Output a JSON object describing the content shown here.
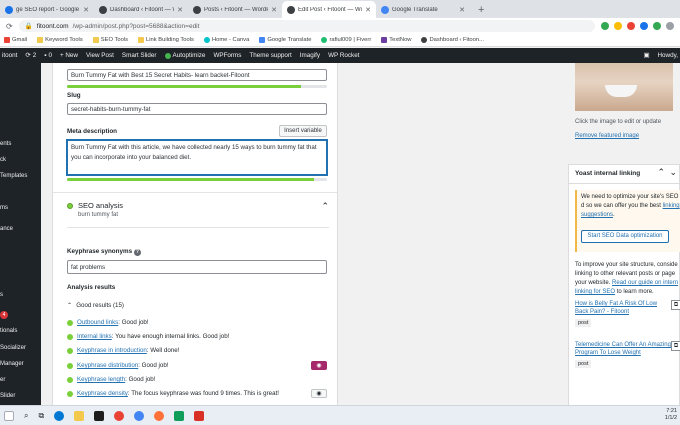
{
  "browser": {
    "tabs": [
      {
        "label": "ge SEO report - Google S",
        "color": "#1a73e8"
      },
      {
        "label": "Dashboard ‹ Fitoont — WordPre",
        "color": "#3c4043"
      },
      {
        "label": "Posts ‹ Fitoont — WordPress",
        "color": "#3c4043"
      },
      {
        "label": "Edit Post ‹ Fitoont — WordPress",
        "color": "#3c4043"
      },
      {
        "label": "Google Translate",
        "color": "#4285f4"
      }
    ],
    "url_host": "fitoont.com",
    "url_path": "/wp-admin/post.php?post=5688&action=edit",
    "bookmarks": [
      "Gmail",
      "Keyword Tools",
      "SEO Tools",
      "Link Building Tools",
      "Home - Canva",
      "Google Translate",
      "rafiul009 | Fiverr",
      "TextNow",
      "Dashboard ‹ Fitoon..."
    ]
  },
  "adminbar": {
    "site": "itoont",
    "updates": "2",
    "comments": "0",
    "items": [
      "+ New",
      "View Post",
      "Smart Slider",
      "Autoptimize",
      "WPForms",
      "Theme support",
      "Imagify",
      "WP Rocket"
    ],
    "howdy": "Howdy,"
  },
  "sidebar": {
    "items": [
      "ents",
      "ck",
      "Templates",
      "ms",
      "ance",
      "s",
      "tionals",
      "Socializer",
      "Manager",
      "er",
      "Slider"
    ],
    "badge": "4"
  },
  "seo": {
    "seo_title": "Burn Tummy Fat with Best 15 Secret Habits- learn backet-Fitoont",
    "seo_title_progress": 0.9,
    "slug_label": "Slug",
    "slug_value": "secret-habits-burn-tummy-fat",
    "meta_label": "Meta description",
    "insert_variable": "Insert variable",
    "meta_value": "Burn Tummy Fat with this article, we have collected nearly 15 ways to burn tummy fat that you can incorporate into your balanced diet.",
    "meta_progress": 0.95,
    "analysis_title": "SEO analysis",
    "analysis_keyphrase": "burn tummy fat",
    "synonyms_label": "Keyphrase synonyms",
    "synonyms_value": "fat problems",
    "results_label": "Analysis results",
    "good_results": "Good results (15)",
    "results": [
      {
        "link": "Outbound links",
        "text": ": Good job!",
        "eye": false
      },
      {
        "link": "Internal links",
        "text": ": You have enough internal links. Good job!",
        "eye": false
      },
      {
        "link": "Keyphrase in introduction",
        "text": ": Well done!",
        "eye": false
      },
      {
        "link": "Keyphrase distribution",
        "text": ": Good job!",
        "eye": true,
        "eye_active": true
      },
      {
        "link": "Keyphrase length",
        "text": ": Good job!",
        "eye": false
      },
      {
        "link": "Keyphrase density",
        "text": ": The focus keyphrase was found 9 times. This is great!",
        "eye": true,
        "eye_active": false
      }
    ]
  },
  "right": {
    "image_help": "Click the image to edit or update",
    "remove_image": "Remove featured image",
    "yoast_title": "Yoast internal linking",
    "notice": "We need to optimize your site's SEO d so we can offer you the best ",
    "notice_link": "linking suggestions",
    "start_btn": "Start SEO Data optimization",
    "improve_text": "To improve your site structure, conside linking to other relevant posts or page your website. ",
    "improve_link": "Read our guide on intern linking for SEO",
    "improve_tail": " to learn more.",
    "suggestions": [
      {
        "title": "How is Belly Fat A Risk Of Low Back Pain? - Fitoont",
        "tag": "post"
      },
      {
        "title": "Telemedicine Can Offer An Amazing Program To Lose Weight",
        "tag": "post"
      }
    ]
  },
  "taskbar": {
    "time": "7:21",
    "date": "1/1/2"
  },
  "colors": {
    "good": "#7ad03a",
    "link": "#2271b1",
    "admin_bg": "#1d2327",
    "eye_active": "#a4286a"
  }
}
